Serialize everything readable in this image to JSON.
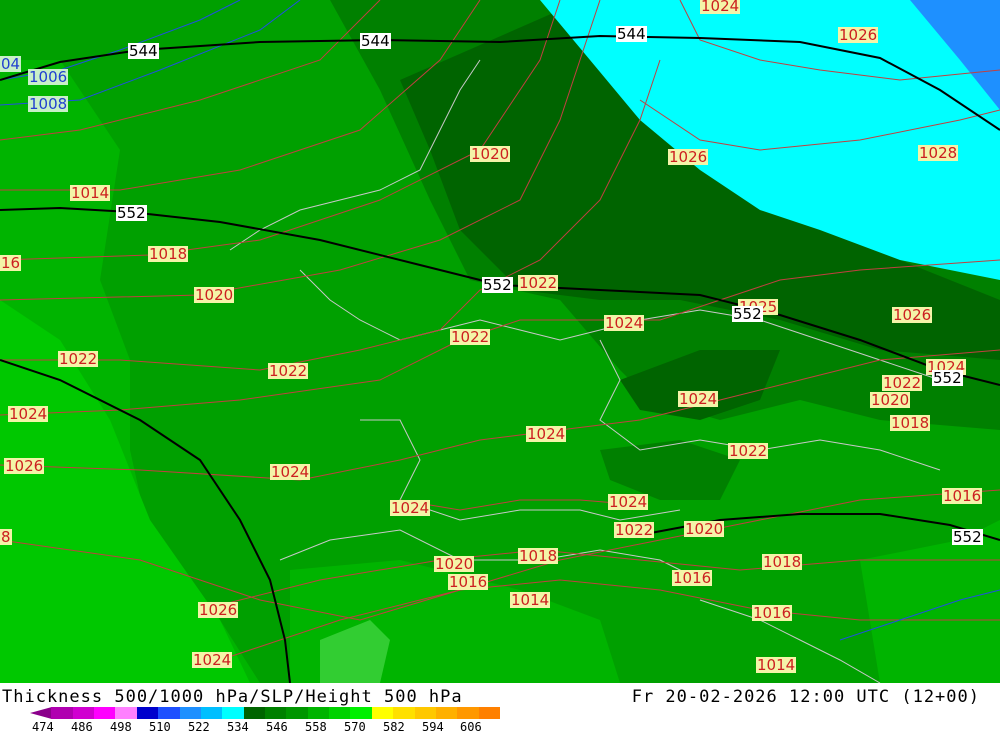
{
  "map": {
    "slp_labels": [
      {
        "text": "1024",
        "color": "red"
      },
      {
        "text": "1026",
        "color": "red"
      },
      {
        "text": "04",
        "color": "blue"
      },
      {
        "text": "1006",
        "color": "blue"
      },
      {
        "text": "1008",
        "color": "blue"
      },
      {
        "text": "1020",
        "color": "red"
      },
      {
        "text": "1026",
        "color": "red"
      },
      {
        "text": "1028",
        "color": "red"
      },
      {
        "text": "1014",
        "color": "red"
      },
      {
        "text": "16",
        "color": "red"
      },
      {
        "text": "1018",
        "color": "red"
      },
      {
        "text": "1020",
        "color": "red"
      },
      {
        "text": "1022",
        "color": "red"
      },
      {
        "text": "1022",
        "color": "red"
      },
      {
        "text": "1022",
        "color": "red"
      },
      {
        "text": "1024",
        "color": "red"
      },
      {
        "text": "1025",
        "color": "red"
      },
      {
        "text": "1026",
        "color": "red"
      },
      {
        "text": "1022",
        "color": "red"
      },
      {
        "text": "1024",
        "color": "red"
      },
      {
        "text": "1024",
        "color": "red"
      },
      {
        "text": "1026",
        "color": "red"
      },
      {
        "text": "1022",
        "color": "red"
      },
      {
        "text": "1020",
        "color": "red"
      },
      {
        "text": "1024",
        "color": "red"
      },
      {
        "text": "1024",
        "color": "red"
      },
      {
        "text": "1018",
        "color": "red"
      },
      {
        "text": "1024",
        "color": "red"
      },
      {
        "text": "1022",
        "color": "red"
      },
      {
        "text": "1016",
        "color": "red"
      },
      {
        "text": "1024",
        "color": "red"
      },
      {
        "text": "1024",
        "color": "red"
      },
      {
        "text": "8",
        "color": "red"
      },
      {
        "text": "1022",
        "color": "red"
      },
      {
        "text": "1020",
        "color": "red"
      },
      {
        "text": "1020",
        "color": "red"
      },
      {
        "text": "1018",
        "color": "red"
      },
      {
        "text": "1016",
        "color": "red"
      },
      {
        "text": "1016",
        "color": "red"
      },
      {
        "text": "1018",
        "color": "red"
      },
      {
        "text": "1014",
        "color": "red"
      },
      {
        "text": "1026",
        "color": "red"
      },
      {
        "text": "1016",
        "color": "red"
      },
      {
        "text": "1024",
        "color": "red"
      },
      {
        "text": "1014",
        "color": "red"
      }
    ],
    "height_labels": [
      {
        "text": "544"
      },
      {
        "text": "544"
      },
      {
        "text": "544"
      },
      {
        "text": "552"
      },
      {
        "text": "552"
      },
      {
        "text": "552"
      },
      {
        "text": "552"
      },
      {
        "text": "552"
      }
    ],
    "colors": {
      "sea_cyan": "#00ffff",
      "deep_blue": "#1e90ff",
      "green_dark": "#006400",
      "green_mid": "#008c00",
      "green": "#00a000",
      "green_light": "#00c800",
      "bright_green": "#32cd32",
      "slp_contour": "#c04040",
      "height_contour": "#000000",
      "border": "#c0c0c0"
    }
  },
  "footer": {
    "title_left": "Thickness 500/1000 hPa/SLP/Height 500 hPa",
    "title_right": "Fr 20-02-2026 12:00 UTC (12+00)",
    "colorbar_ticks": [
      "474",
      "486",
      "498",
      "510",
      "522",
      "534",
      "546",
      "558",
      "570",
      "582",
      "594",
      "606"
    ],
    "colorbar_colors": [
      "#8b008b",
      "#b000b0",
      "#d000d0",
      "#ff00ff",
      "#ff80ff",
      "#0000cd",
      "#1e50ff",
      "#1e90ff",
      "#00bfff",
      "#00ffff",
      "#006400",
      "#008000",
      "#009600",
      "#00b400",
      "#00d200",
      "#00f000",
      "#ffff00",
      "#ffe000",
      "#ffc800",
      "#ffb000",
      "#ff9800",
      "#ff8000"
    ]
  }
}
